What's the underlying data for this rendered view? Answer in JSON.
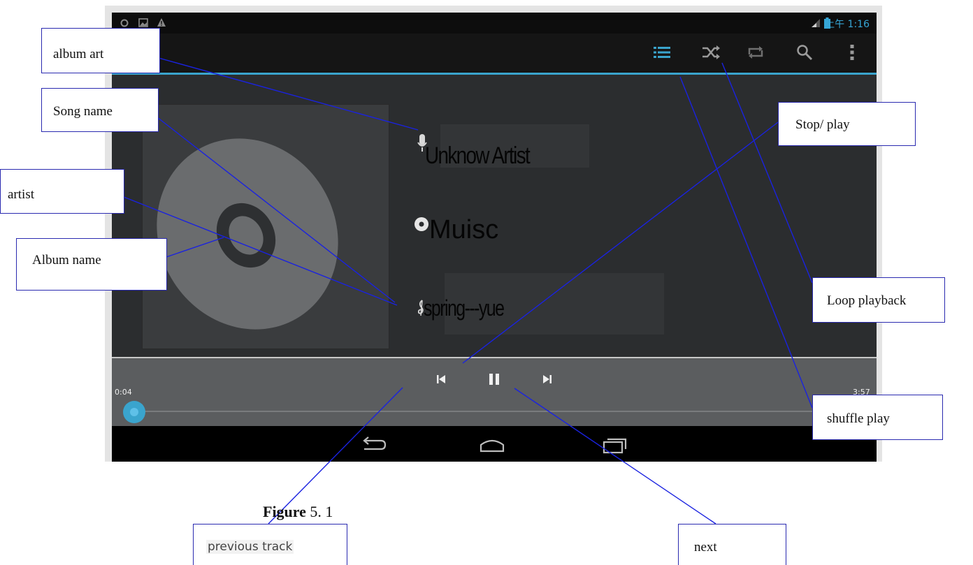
{
  "status_bar": {
    "icons": [
      "settings-icon",
      "image-icon",
      "warning-icon",
      "signal-icon",
      "battery-icon"
    ],
    "clock": "上午 1:16"
  },
  "action_bar": {
    "icons": [
      "playlist-icon",
      "shuffle-icon",
      "repeat-icon",
      "search-icon",
      "overflow-menu-icon"
    ],
    "accent_color": "#3aa4cd"
  },
  "now_playing": {
    "artist": "Unknow Artist",
    "album": "Muisc",
    "song": "spring---yue",
    "artist_icon": "microphone-icon",
    "album_icon": "disc-icon",
    "song_icon": "treble-clef-icon"
  },
  "controls": {
    "elapsed": "0:04",
    "duration": "3:57",
    "progress_fraction": 0.017,
    "buttons": [
      "previous-icon",
      "pause-icon",
      "next-icon"
    ]
  },
  "navigation": {
    "buttons": [
      "back-icon",
      "home-icon",
      "recent-apps-icon"
    ]
  },
  "annotations": {
    "album_art": "album art",
    "song_name": "Song name",
    "artist": "artist",
    "album_name": "Album name",
    "stop_play": "Stop/ play",
    "loop_playback": "Loop playback",
    "shuffle_play": "shuffle play",
    "previous_track": "previous track",
    "next": "next"
  },
  "figure": {
    "label": "Figure",
    "number": "5. 1"
  }
}
